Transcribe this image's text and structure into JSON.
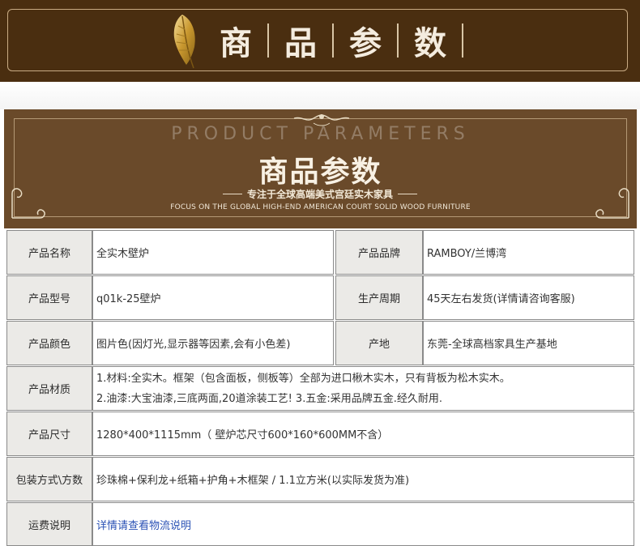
{
  "banner": {
    "title_chars": [
      "商",
      "品",
      "参",
      "数"
    ],
    "icon": "feather-icon"
  },
  "header": {
    "en_title": "PRODUCT PARAMETERS",
    "cn_title": "商品参数",
    "subtitle": "专注于全球高端美式宫廷实木家具",
    "en_subtitle": "FOCUS ON THE GLOBAL HIGH-END AMERICAN COURT SOLID WOOD FURNITURE"
  },
  "specs": {
    "name_label": "产品名称",
    "name_value": "全实木壁炉",
    "brand_label": "产品品牌",
    "brand_value": "RAMBOY/兰博湾",
    "model_label": "产品型号",
    "model_value": "q01k-25壁炉",
    "cycle_label": "生产周期",
    "cycle_value": "45天左右发货(详情请咨询客服)",
    "color_label": "产品颜色",
    "color_value": "图片色(因灯光,显示器等因素,会有小色差)",
    "origin_label": "产地",
    "origin_value": "东莞-全球高档家具生产基地",
    "material_label": "产品材质",
    "material_line1": "1.材料:全实木。框架（包含面板，侧板等）全部为进口楸木实木，只有背板为松木实木。",
    "material_line2": "2.油漆:大宝油漆,三底两面,20道涂装工艺!  3.五金:采用品牌五金.经久耐用.",
    "size_label": "产品尺寸",
    "size_value": "1280*400*1115mm（ 壁炉芯尺寸600*160*600MM不含）",
    "package_label": "包装方式\\方数",
    "package_value": "珍珠棉+保利龙+纸箱+护角+木框架 / 1.1立方米(以实际发货为准)",
    "shipping_label": "运费说明",
    "shipping_value": "详情请查看物流说明"
  },
  "colors": {
    "banner_bg": "#4a2e10",
    "header_bg": "#6a4a2a",
    "label_bg": "#ebeae7",
    "link": "#2b52b5"
  }
}
